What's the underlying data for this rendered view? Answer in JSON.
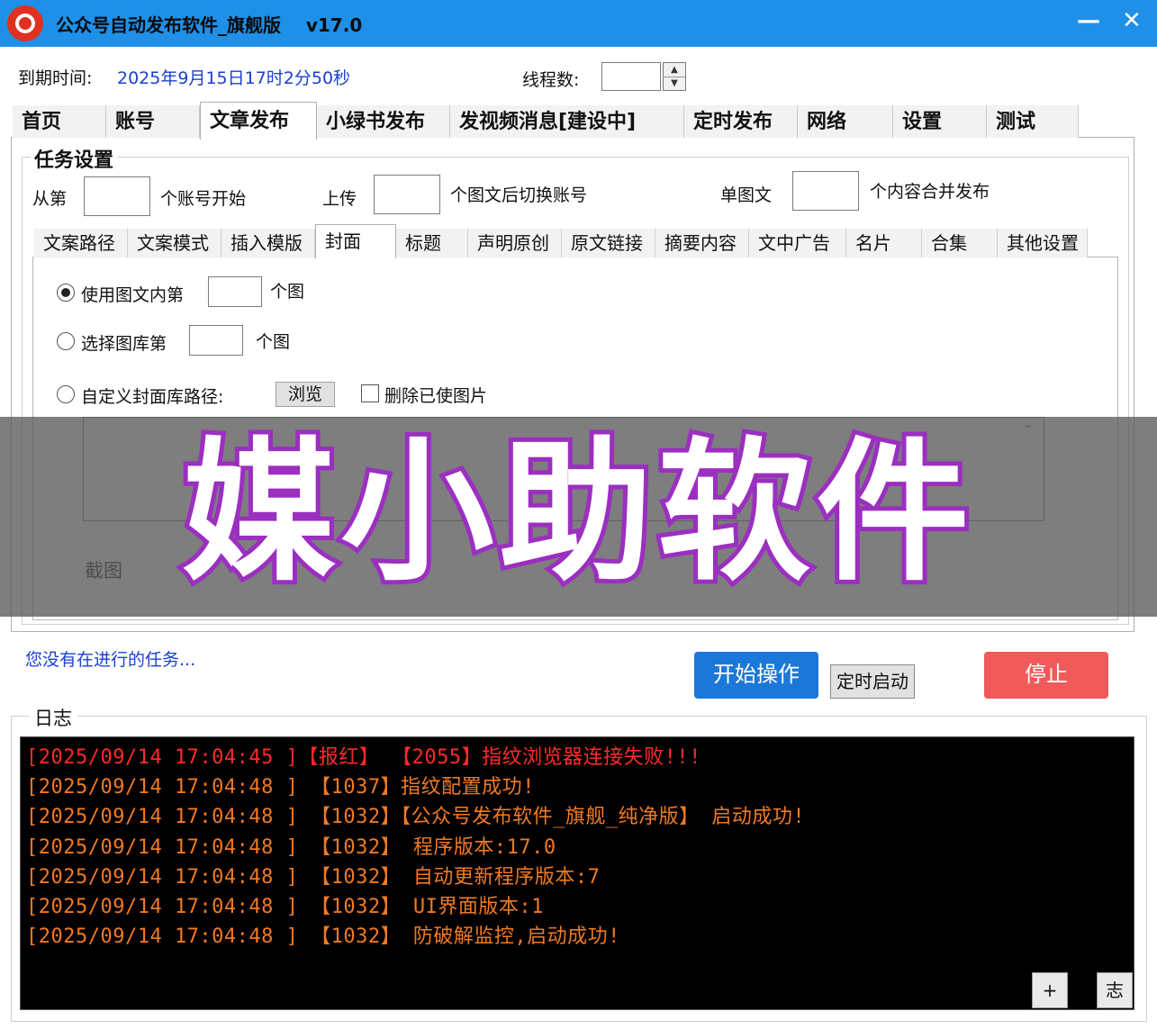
{
  "window": {
    "title": "公众号自动发布软件_旗舰版    v17.0",
    "minimize": "—",
    "close": "✕",
    "logo_icon": "app-logo-icon"
  },
  "header": {
    "expiry_label": "到期时间:",
    "expiry_value": "2025年9月15日17时2分50秒",
    "threads_label": "线程数:",
    "threads_value": "",
    "spin_up": "▲",
    "spin_down": "▼"
  },
  "main_tabs": [
    {
      "label": "首页"
    },
    {
      "label": "账号"
    },
    {
      "label": "文章发布"
    },
    {
      "label": "小绿书发布"
    },
    {
      "label": "发视频消息[建设中]"
    },
    {
      "label": "定时发布"
    },
    {
      "label": "网络"
    },
    {
      "label": "设置"
    },
    {
      "label": "测试"
    }
  ],
  "active_main_tab": "文章发布",
  "task": {
    "group_title": "任务设置",
    "from_label": "从第",
    "from_value": "",
    "start_suffix": "个账号开始",
    "upload_label": "上传",
    "upload_value": "",
    "switch_suffix": "个图文后切换账号",
    "single_label": "单图文",
    "single_value": "",
    "merge_suffix": "个内容合并发布"
  },
  "sub_tabs": [
    {
      "label": "文案路径"
    },
    {
      "label": "文案模式"
    },
    {
      "label": "插入模版"
    },
    {
      "label": "封面"
    },
    {
      "label": "标题"
    },
    {
      "label": "声明原创"
    },
    {
      "label": "原文链接"
    },
    {
      "label": "摘要内容"
    },
    {
      "label": "文中广告"
    },
    {
      "label": "名片"
    },
    {
      "label": "合集"
    },
    {
      "label": "其他设置"
    }
  ],
  "active_sub_tab": "封面",
  "cover": {
    "opt1_label": "使用图文内第",
    "opt1_value": "",
    "opt1_suffix": "个图",
    "opt2_label": "选择图库第",
    "opt2_value": "",
    "opt2_suffix": "个图",
    "opt3_label": "自定义封面库路径:",
    "browse": "浏览",
    "delete_used": "删除已使图片",
    "path_value": "",
    "screenshot_label": "截图",
    "selected": "opt1"
  },
  "watermark": "媒小助软件",
  "status": "您没有在进行的任务...",
  "buttons": {
    "start": "开始操作",
    "timer": "定时启动",
    "stop": "停止"
  },
  "log": {
    "title": "日志",
    "lines": [
      {
        "time": "[2025/09/14 17:04:45 ]",
        "text": "【报红】 【2055】指纹浏览器连接失败!!!",
        "color": "red"
      },
      {
        "time": "[2025/09/14 17:04:48 ]",
        "text": " 【1037】指纹配置成功!",
        "color": "orange"
      },
      {
        "time": "[2025/09/14 17:04:48 ]",
        "text": " 【1032】【公众号发布软件_旗舰_纯净版】 启动成功!",
        "color": "orange"
      },
      {
        "time": "[2025/09/14 17:04:48 ]",
        "text": " 【1032】 程序版本:17.0",
        "color": "orange"
      },
      {
        "time": "[2025/09/14 17:04:48 ]",
        "text": " 【1032】 自动更新程序版本:7",
        "color": "orange"
      },
      {
        "time": "[2025/09/14 17:04:48 ]",
        "text": " 【1032】 UI界面版本:1",
        "color": "orange"
      },
      {
        "time": "[2025/09/14 17:04:48 ]",
        "text": " 【1032】 防破解监控,启动成功!",
        "color": "orange"
      }
    ],
    "plus_button": "+",
    "log_button": "志"
  },
  "colors": {
    "titlebar": "#1e90e8",
    "start_button": "#1c78d8",
    "stop_button": "#f05a5a",
    "log_red": "#ff2a2a",
    "log_orange": "#f07a22",
    "watermark_stroke": "#9b2fc0"
  }
}
